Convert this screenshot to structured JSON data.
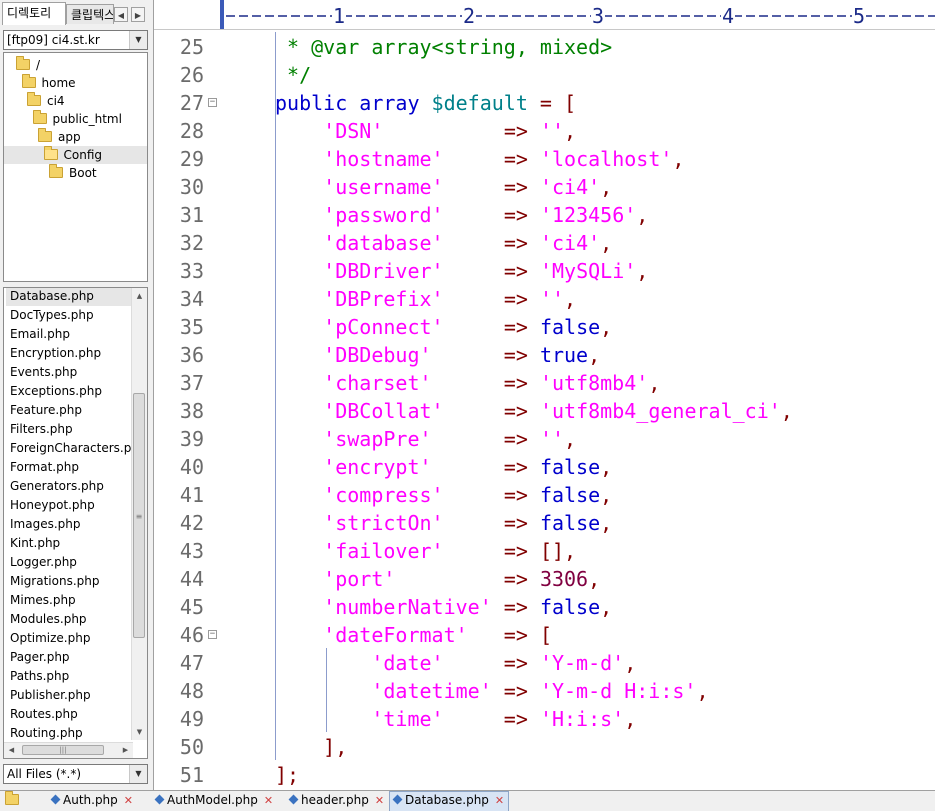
{
  "left_panel": {
    "tabs": [
      {
        "label": "디렉토리",
        "active": true
      },
      {
        "label": "클립텍스",
        "active": false
      }
    ],
    "ftp_site": "[ftp09] ci4.st.kr",
    "tree": [
      {
        "label": "/",
        "depth": 0
      },
      {
        "label": "home",
        "depth": 1
      },
      {
        "label": "ci4",
        "depth": 2
      },
      {
        "label": "public_html",
        "depth": 3
      },
      {
        "label": "app",
        "depth": 4
      },
      {
        "label": "Config",
        "depth": 5,
        "selected": true
      },
      {
        "label": "Boot",
        "depth": 6
      }
    ],
    "files": [
      "Database.php",
      "DocTypes.php",
      "Email.php",
      "Encryption.php",
      "Events.php",
      "Exceptions.php",
      "Feature.php",
      "Filters.php",
      "ForeignCharacters.php",
      "Format.php",
      "Generators.php",
      "Honeypot.php",
      "Images.php",
      "Kint.php",
      "Logger.php",
      "Migrations.php",
      "Mimes.php",
      "Modules.php",
      "Optimize.php",
      "Pager.php",
      "Paths.php",
      "Publisher.php",
      "Routes.php",
      "Routing.php"
    ],
    "selected_file": "Database.php",
    "filter": "All Files (*.*)"
  },
  "ruler": {
    "labels": [
      "1",
      "2",
      "3",
      "4",
      "5"
    ]
  },
  "code_lines": [
    {
      "num": "25",
      "tokens": [
        [
          "c",
          " * @var array<string, mixed>"
        ]
      ]
    },
    {
      "num": "26",
      "tokens": [
        [
          "c",
          " */"
        ]
      ]
    },
    {
      "num": "27",
      "fold": true,
      "tokens": [
        [
          "k",
          "public array "
        ],
        [
          "v",
          "$default"
        ],
        [
          "t",
          " "
        ],
        [
          "p",
          "= ["
        ]
      ]
    },
    {
      "num": "28",
      "tokens": [
        [
          "t",
          "    "
        ],
        [
          "s",
          "'DSN'"
        ],
        [
          "t",
          "          "
        ],
        [
          "p",
          "=>"
        ],
        [
          "t",
          " "
        ],
        [
          "s",
          "''"
        ],
        [
          "p",
          ","
        ]
      ]
    },
    {
      "num": "29",
      "tokens": [
        [
          "t",
          "    "
        ],
        [
          "s",
          "'hostname'"
        ],
        [
          "t",
          "     "
        ],
        [
          "p",
          "=>"
        ],
        [
          "t",
          " "
        ],
        [
          "s",
          "'localhost'"
        ],
        [
          "p",
          ","
        ]
      ]
    },
    {
      "num": "30",
      "tokens": [
        [
          "t",
          "    "
        ],
        [
          "s",
          "'username'"
        ],
        [
          "t",
          "     "
        ],
        [
          "p",
          "=>"
        ],
        [
          "t",
          " "
        ],
        [
          "s",
          "'ci4'"
        ],
        [
          "p",
          ","
        ]
      ]
    },
    {
      "num": "31",
      "tokens": [
        [
          "t",
          "    "
        ],
        [
          "s",
          "'password'"
        ],
        [
          "t",
          "     "
        ],
        [
          "p",
          "=>"
        ],
        [
          "t",
          " "
        ],
        [
          "s",
          "'123456'"
        ],
        [
          "p",
          ","
        ]
      ]
    },
    {
      "num": "32",
      "tokens": [
        [
          "t",
          "    "
        ],
        [
          "s",
          "'database'"
        ],
        [
          "t",
          "     "
        ],
        [
          "p",
          "=>"
        ],
        [
          "t",
          " "
        ],
        [
          "s",
          "'ci4'"
        ],
        [
          "p",
          ","
        ]
      ]
    },
    {
      "num": "33",
      "tokens": [
        [
          "t",
          "    "
        ],
        [
          "s",
          "'DBDriver'"
        ],
        [
          "t",
          "     "
        ],
        [
          "p",
          "=>"
        ],
        [
          "t",
          " "
        ],
        [
          "s",
          "'MySQLi'"
        ],
        [
          "p",
          ","
        ]
      ]
    },
    {
      "num": "34",
      "tokens": [
        [
          "t",
          "    "
        ],
        [
          "s",
          "'DBPrefix'"
        ],
        [
          "t",
          "     "
        ],
        [
          "p",
          "=>"
        ],
        [
          "t",
          " "
        ],
        [
          "s",
          "''"
        ],
        [
          "p",
          ","
        ]
      ]
    },
    {
      "num": "35",
      "tokens": [
        [
          "t",
          "    "
        ],
        [
          "s",
          "'pConnect'"
        ],
        [
          "t",
          "     "
        ],
        [
          "p",
          "=>"
        ],
        [
          "t",
          " "
        ],
        [
          "k",
          "false"
        ],
        [
          "p",
          ","
        ]
      ]
    },
    {
      "num": "36",
      "tokens": [
        [
          "t",
          "    "
        ],
        [
          "s",
          "'DBDebug'"
        ],
        [
          "t",
          "      "
        ],
        [
          "p",
          "=>"
        ],
        [
          "t",
          " "
        ],
        [
          "k",
          "true"
        ],
        [
          "p",
          ","
        ]
      ]
    },
    {
      "num": "37",
      "tokens": [
        [
          "t",
          "    "
        ],
        [
          "s",
          "'charset'"
        ],
        [
          "t",
          "      "
        ],
        [
          "p",
          "=>"
        ],
        [
          "t",
          " "
        ],
        [
          "s",
          "'utf8mb4'"
        ],
        [
          "p",
          ","
        ]
      ]
    },
    {
      "num": "38",
      "tokens": [
        [
          "t",
          "    "
        ],
        [
          "s",
          "'DBCollat'"
        ],
        [
          "t",
          "     "
        ],
        [
          "p",
          "=>"
        ],
        [
          "t",
          " "
        ],
        [
          "s",
          "'utf8mb4_general_ci'"
        ],
        [
          "p",
          ","
        ]
      ]
    },
    {
      "num": "39",
      "tokens": [
        [
          "t",
          "    "
        ],
        [
          "s",
          "'swapPre'"
        ],
        [
          "t",
          "      "
        ],
        [
          "p",
          "=>"
        ],
        [
          "t",
          " "
        ],
        [
          "s",
          "''"
        ],
        [
          "p",
          ","
        ]
      ]
    },
    {
      "num": "40",
      "tokens": [
        [
          "t",
          "    "
        ],
        [
          "s",
          "'encrypt'"
        ],
        [
          "t",
          "      "
        ],
        [
          "p",
          "=>"
        ],
        [
          "t",
          " "
        ],
        [
          "k",
          "false"
        ],
        [
          "p",
          ","
        ]
      ]
    },
    {
      "num": "41",
      "tokens": [
        [
          "t",
          "    "
        ],
        [
          "s",
          "'compress'"
        ],
        [
          "t",
          "     "
        ],
        [
          "p",
          "=>"
        ],
        [
          "t",
          " "
        ],
        [
          "k",
          "false"
        ],
        [
          "p",
          ","
        ]
      ]
    },
    {
      "num": "42",
      "tokens": [
        [
          "t",
          "    "
        ],
        [
          "s",
          "'strictOn'"
        ],
        [
          "t",
          "     "
        ],
        [
          "p",
          "=>"
        ],
        [
          "t",
          " "
        ],
        [
          "k",
          "false"
        ],
        [
          "p",
          ","
        ]
      ]
    },
    {
      "num": "43",
      "tokens": [
        [
          "t",
          "    "
        ],
        [
          "s",
          "'failover'"
        ],
        [
          "t",
          "     "
        ],
        [
          "p",
          "=>"
        ],
        [
          "t",
          " "
        ],
        [
          "p",
          "[],"
        ]
      ]
    },
    {
      "num": "44",
      "tokens": [
        [
          "t",
          "    "
        ],
        [
          "s",
          "'port'"
        ],
        [
          "t",
          "         "
        ],
        [
          "p",
          "=>"
        ],
        [
          "t",
          " "
        ],
        [
          "n",
          "3306"
        ],
        [
          "p",
          ","
        ]
      ]
    },
    {
      "num": "45",
      "tokens": [
        [
          "t",
          "    "
        ],
        [
          "s",
          "'numberNative'"
        ],
        [
          "t",
          " "
        ],
        [
          "p",
          "=>"
        ],
        [
          "t",
          " "
        ],
        [
          "k",
          "false"
        ],
        [
          "p",
          ","
        ]
      ]
    },
    {
      "num": "46",
      "fold": true,
      "tokens": [
        [
          "t",
          "    "
        ],
        [
          "s",
          "'dateFormat'"
        ],
        [
          "t",
          "   "
        ],
        [
          "p",
          "=>"
        ],
        [
          "t",
          " "
        ],
        [
          "p",
          "["
        ]
      ]
    },
    {
      "num": "47",
      "tokens": [
        [
          "t",
          "        "
        ],
        [
          "s",
          "'date'"
        ],
        [
          "t",
          "     "
        ],
        [
          "p",
          "=>"
        ],
        [
          "t",
          " "
        ],
        [
          "s",
          "'Y-m-d'"
        ],
        [
          "p",
          ","
        ]
      ]
    },
    {
      "num": "48",
      "tokens": [
        [
          "t",
          "        "
        ],
        [
          "s",
          "'datetime'"
        ],
        [
          "t",
          " "
        ],
        [
          "p",
          "=>"
        ],
        [
          "t",
          " "
        ],
        [
          "s",
          "'Y-m-d H:i:s'"
        ],
        [
          "p",
          ","
        ]
      ]
    },
    {
      "num": "49",
      "tokens": [
        [
          "t",
          "        "
        ],
        [
          "s",
          "'time'"
        ],
        [
          "t",
          "     "
        ],
        [
          "p",
          "=>"
        ],
        [
          "t",
          " "
        ],
        [
          "s",
          "'H:i:s'"
        ],
        [
          "p",
          ","
        ]
      ]
    },
    {
      "num": "50",
      "tokens": [
        [
          "t",
          "    "
        ],
        [
          "p",
          "],"
        ]
      ]
    },
    {
      "num": "51",
      "tokens": [
        [
          "p",
          "];"
        ]
      ]
    }
  ],
  "bottom_tabs": [
    {
      "label": "Auth.php",
      "active": false
    },
    {
      "label": "AuthModel.php",
      "active": false
    },
    {
      "label": "header.php",
      "active": false
    },
    {
      "label": "Database.php",
      "active": true
    }
  ],
  "colors": {
    "comment": "#008000",
    "keyword": "#0000cc",
    "variable": "#00808a",
    "punctuation": "#800000",
    "string": "#ff00ff",
    "number": "#800040"
  }
}
